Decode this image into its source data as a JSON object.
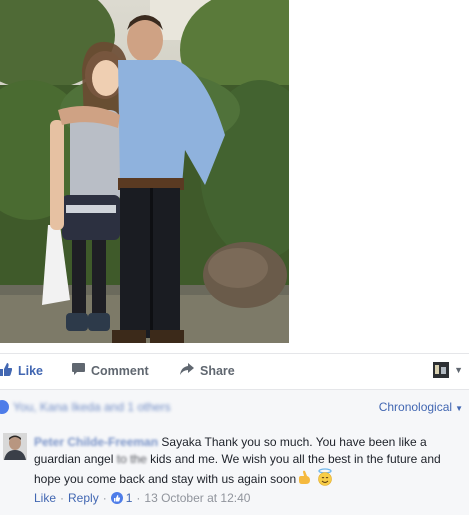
{
  "post": {
    "actions": {
      "like_label": "Like",
      "comment_label": "Comment",
      "share_label": "Share"
    }
  },
  "reactions": {
    "summary_text": "You, Kana Ikeda and 1 others",
    "sort_label": "Chronological"
  },
  "comment": {
    "author": "Peter Childe-Freeman",
    "text_part1": "Sayaka Thank you so much. You have been like a guardian angel ",
    "text_blur": "to the",
    "text_part2": " kids and me. We wish you all the best in the future and hope you come back and stay with us again soon",
    "like_label": "Like",
    "reply_label": "Reply",
    "like_count": "1",
    "timestamp": "13 October at 12:40"
  },
  "colors": {
    "link_blue": "#4267b2",
    "muted": "#606770",
    "panel_bg": "#f6f7f9"
  }
}
